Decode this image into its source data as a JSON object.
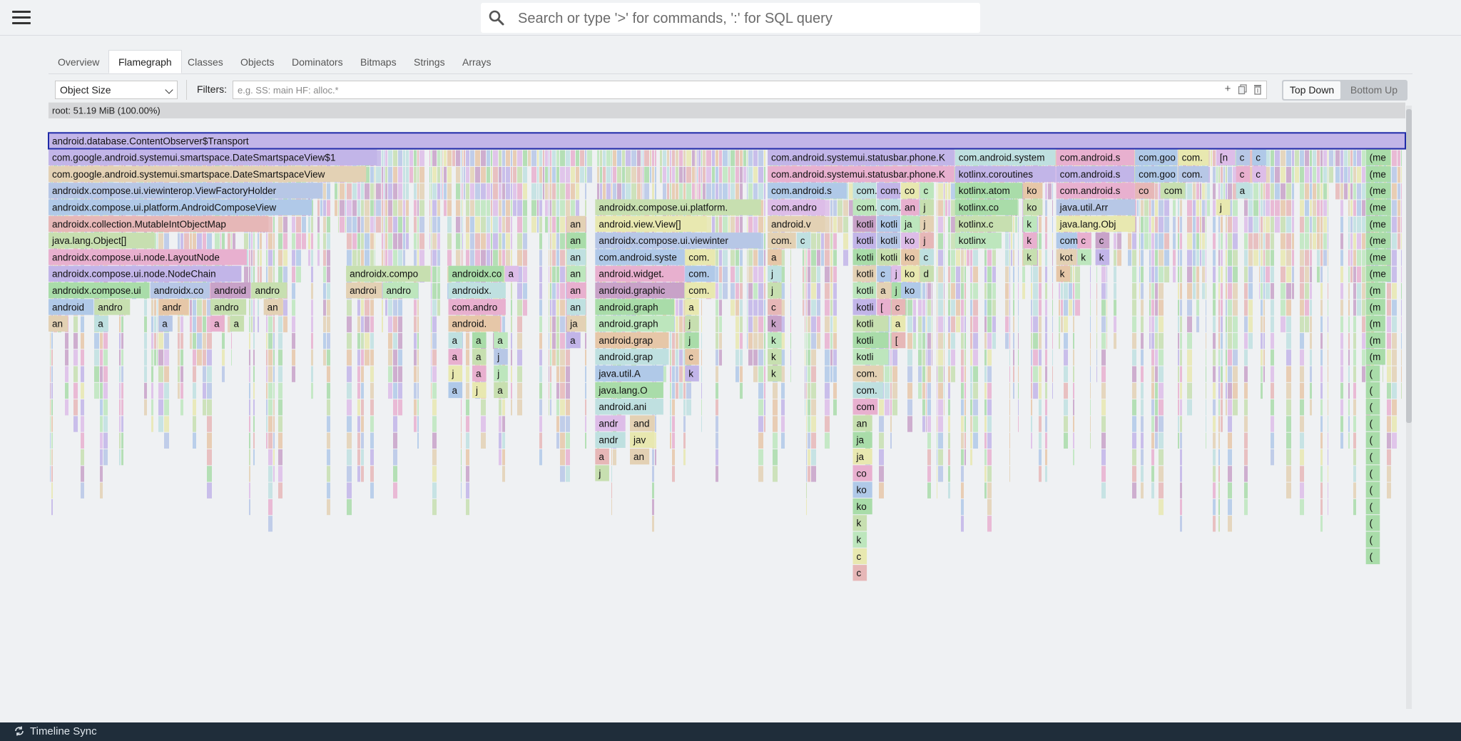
{
  "search": {
    "placeholder": "Search or type '>' for commands, ':' for SQL query"
  },
  "tabs": [
    {
      "label": "Overview",
      "active": false
    },
    {
      "label": "Flamegraph",
      "active": true
    },
    {
      "label": "Classes",
      "active": false
    },
    {
      "label": "Objects",
      "active": false
    },
    {
      "label": "Dominators",
      "active": false
    },
    {
      "label": "Bitmaps",
      "active": false
    },
    {
      "label": "Strings",
      "active": false
    },
    {
      "label": "Arrays",
      "active": false
    }
  ],
  "controls": {
    "metric": "Object Size",
    "filters_label": "Filters:",
    "filters_placeholder": "e.g. SS: main HF: alloc.*",
    "add_icon": "plus-icon",
    "copy_icon": "copy-icon",
    "delete_icon": "trash-icon",
    "top_down": "Top Down",
    "bottom_up": "Bottom Up"
  },
  "flame": {
    "colors": [
      "#c8a2c8",
      "#b7c7e6",
      "#bde6bd",
      "#e6c7a8",
      "#e6b7b7",
      "#bfe0e0",
      "#ddbde8",
      "#e8e8b0",
      "#a9dca9",
      "#c2b5e8",
      "#e8b0cf",
      "#c7dfb0",
      "#b0c9e8",
      "#e3d1b4"
    ],
    "root_label": "root: 51.19 MiB (100.00%)",
    "selected_label": "android.database.ContentObserver$Transport",
    "frames": [
      [
        3,
        0,
        "android.database.ContentObserver$Transport",
        9,
        1
      ],
      [
        4,
        0,
        "com.google.android.systemui.smartspace.DateSmartspaceView$1",
        9
      ],
      [
        4,
        0.53,
        "com.android.systemui.statusbar.phone.K",
        9
      ],
      [
        4,
        0.6681,
        "com.android.system",
        5
      ],
      [
        4,
        0.7427,
        "com.android.s",
        10
      ],
      [
        4,
        0.8008,
        "com.goo",
        12
      ],
      [
        4,
        0.8326,
        "com.",
        7
      ],
      [
        4,
        0.8606,
        "[n",
        6
      ],
      [
        4,
        0.8752,
        "c",
        1
      ],
      [
        4,
        0.8871,
        "c",
        12
      ],
      [
        4,
        0.9709,
        "(me",
        8
      ],
      [
        5,
        0,
        "com.google.android.systemui.smartspace.DateSmartspaceView",
        13
      ],
      [
        5,
        0.53,
        "com.android.systemui.statusbar.phone.K",
        10
      ],
      [
        5,
        0.6681,
        "kotlinx.coroutines",
        9
      ],
      [
        5,
        0.7427,
        "com.android.s",
        9
      ],
      [
        5,
        0.8008,
        "com.goo",
        12
      ],
      [
        5,
        0.8326,
        "com.",
        1
      ],
      [
        5,
        0.8752,
        "c",
        10
      ],
      [
        5,
        0.8871,
        "c",
        6
      ],
      [
        5,
        0.9709,
        "(me",
        8
      ],
      [
        6,
        0,
        "androidx.compose.ui.viewinterop.ViewFactoryHolder",
        1
      ],
      [
        6,
        0.53,
        "com.android.s",
        12
      ],
      [
        6,
        0.5928,
        "com.a",
        5
      ],
      [
        6,
        0.6105,
        "com.a",
        9
      ],
      [
        6,
        0.6283,
        "co",
        7
      ],
      [
        6,
        0.6422,
        "c",
        2
      ],
      [
        6,
        0.6681,
        "kotlinx.atom",
        8
      ],
      [
        6,
        0.7183,
        "ko",
        3
      ],
      [
        6,
        0.7427,
        "com.android.s",
        10
      ],
      [
        6,
        0.8008,
        "co",
        4
      ],
      [
        6,
        0.8195,
        "com",
        11
      ],
      [
        6,
        0.8752,
        "a",
        5
      ],
      [
        6,
        0.9709,
        "(me",
        8
      ],
      [
        7,
        0,
        "androidx.compose.ui.platform.AndroidComposeView",
        12
      ],
      [
        7,
        0.4029,
        "androidx.compose.ui.platform.",
        11
      ],
      [
        7,
        0.53,
        "com.andro",
        6
      ],
      [
        7,
        0.5928,
        "com.a",
        2
      ],
      [
        7,
        0.6105,
        "com.a",
        5
      ],
      [
        7,
        0.6283,
        "an",
        10
      ],
      [
        7,
        0.6422,
        "j",
        11
      ],
      [
        7,
        0.6681,
        "kotlinx.co",
        8
      ],
      [
        7,
        0.7183,
        "ko",
        11
      ],
      [
        7,
        0.7427,
        "java.util.Arr",
        1
      ],
      [
        7,
        0.8606,
        "j",
        7
      ],
      [
        7,
        0.9709,
        "(me",
        8
      ],
      [
        8,
        0,
        "androidx.collection.MutableIntObjectMap",
        4
      ],
      [
        8,
        0.3818,
        "an",
        13
      ],
      [
        8,
        0.4029,
        "android.view.View[]",
        7
      ],
      [
        8,
        0.53,
        "android.v",
        13
      ],
      [
        8,
        0.5928,
        "kotli",
        0
      ],
      [
        8,
        0.6105,
        "kotli",
        12
      ],
      [
        8,
        0.6283,
        "ja",
        2
      ],
      [
        8,
        0.6422,
        "j",
        13
      ],
      [
        8,
        0.6681,
        "kotlinx.c",
        11
      ],
      [
        8,
        0.7183,
        "k",
        2
      ],
      [
        8,
        0.7427,
        "java.lang.Obj",
        7
      ],
      [
        8,
        0.9709,
        "(me",
        8
      ],
      [
        9,
        0,
        "java.lang.Object[]",
        11
      ],
      [
        9,
        0.3818,
        "an",
        8
      ],
      [
        9,
        0.4029,
        "androidx.compose.ui.viewinter",
        1
      ],
      [
        9,
        0.53,
        "com.",
        13
      ],
      [
        9,
        0.5514,
        "c",
        5
      ],
      [
        9,
        0.5928,
        "kotli",
        9
      ],
      [
        9,
        0.6105,
        "kotli",
        1
      ],
      [
        9,
        0.6283,
        "ko",
        6
      ],
      [
        9,
        0.6422,
        "j",
        4
      ],
      [
        9,
        0.6681,
        "kotlinx",
        2
      ],
      [
        9,
        0.7183,
        "k",
        10
      ],
      [
        9,
        0.7427,
        "com",
        12
      ],
      [
        9,
        0.7583,
        "c",
        10
      ],
      [
        9,
        0.7716,
        "c",
        0
      ],
      [
        9,
        0.9709,
        "(me",
        8
      ],
      [
        10,
        0,
        "androidx.compose.ui.node.LayoutNode",
        10
      ],
      [
        10,
        0.3818,
        "an",
        5
      ],
      [
        10,
        0.4029,
        "com.android.syste",
        12
      ],
      [
        10,
        0.4691,
        "com.",
        7
      ],
      [
        10,
        0.53,
        "a",
        3
      ],
      [
        10,
        0.5928,
        "kotli",
        8
      ],
      [
        10,
        0.6105,
        "kotli",
        11
      ],
      [
        10,
        0.6283,
        "ko",
        3
      ],
      [
        10,
        0.6422,
        "c",
        5
      ],
      [
        10,
        0.7183,
        "k",
        11
      ],
      [
        10,
        0.7427,
        "kot",
        13
      ],
      [
        10,
        0.7583,
        "k",
        2
      ],
      [
        10,
        0.7716,
        "k",
        9
      ],
      [
        10,
        0.9709,
        "(me",
        8
      ],
      [
        11,
        0,
        "androidx.compose.ui.node.NodeChain",
        9
      ],
      [
        11,
        0.2193,
        "androidx.compo",
        11
      ],
      [
        11,
        0.2947,
        "androidx.co",
        8
      ],
      [
        11,
        0.3362,
        "a",
        6
      ],
      [
        11,
        0.3818,
        "an",
        2
      ],
      [
        11,
        0.4029,
        "android.widget.",
        10
      ],
      [
        11,
        0.4691,
        "com.",
        12
      ],
      [
        11,
        0.53,
        "j",
        5
      ],
      [
        11,
        0.5928,
        "kotli",
        13
      ],
      [
        11,
        0.6105,
        "c",
        12
      ],
      [
        11,
        0.6213,
        "j",
        6
      ],
      [
        11,
        0.6283,
        "ko",
        7
      ],
      [
        11,
        0.6422,
        "d",
        11
      ],
      [
        11,
        0.7427,
        "k",
        3
      ],
      [
        11,
        0.9709,
        "(me",
        8
      ],
      [
        12,
        0,
        "androidx.compose.ui",
        8
      ],
      [
        12,
        0.075,
        "androidx.co",
        1
      ],
      [
        12,
        0.1194,
        "android",
        0
      ],
      [
        12,
        0.1496,
        "andro",
        11
      ],
      [
        12,
        0.2193,
        "androi",
        13
      ],
      [
        12,
        0.2463,
        "andro",
        2
      ],
      [
        12,
        0.2947,
        "androidx.",
        5
      ],
      [
        12,
        0.3818,
        "an",
        10
      ],
      [
        12,
        0.4029,
        "android.graphic",
        0
      ],
      [
        12,
        0.4691,
        "com.",
        7
      ],
      [
        12,
        0.53,
        "j",
        11
      ],
      [
        12,
        0.5928,
        "kotli",
        2
      ],
      [
        12,
        0.6105,
        "a",
        13
      ],
      [
        12,
        0.6213,
        "j",
        8
      ],
      [
        12,
        0.6283,
        "ko",
        12
      ],
      [
        12,
        0.9709,
        "(m",
        8
      ],
      [
        13,
        0,
        "android",
        12
      ],
      [
        13,
        0.0338,
        "andro",
        11
      ],
      [
        13,
        0.0811,
        "andr",
        3
      ],
      [
        13,
        0.1194,
        "andro",
        11
      ],
      [
        13,
        0.1586,
        "an",
        13
      ],
      [
        13,
        0.2947,
        "com.andro",
        10
      ],
      [
        13,
        0.3818,
        "an",
        5
      ],
      [
        13,
        0.4029,
        "android.graph",
        8
      ],
      [
        13,
        0.4691,
        "a",
        7
      ],
      [
        13,
        0.53,
        "c",
        4
      ],
      [
        13,
        0.5928,
        "kotli",
        9
      ],
      [
        13,
        0.6105,
        "[",
        10
      ],
      [
        13,
        0.6213,
        "c",
        4
      ],
      [
        13,
        0.9709,
        "(m",
        8
      ],
      [
        14,
        0,
        "an",
        13
      ],
      [
        14,
        0.0338,
        "a",
        5
      ],
      [
        14,
        0.0811,
        "a",
        1
      ],
      [
        14,
        0.1194,
        "a",
        10
      ],
      [
        14,
        0.1338,
        "a",
        11
      ],
      [
        14,
        0.2947,
        "android.",
        3
      ],
      [
        14,
        0.3818,
        "ja",
        13
      ],
      [
        14,
        0.4029,
        "android.graph",
        2
      ],
      [
        14,
        0.4691,
        "j",
        11
      ],
      [
        14,
        0.53,
        "k",
        0
      ],
      [
        14,
        0.5928,
        "kotli",
        11
      ],
      [
        14,
        0.6213,
        "a",
        7
      ],
      [
        14,
        0.9709,
        "(m",
        8
      ],
      [
        15,
        0.2947,
        "a",
        5
      ],
      [
        15,
        0.3123,
        "a",
        8
      ],
      [
        15,
        0.3282,
        "a",
        2
      ],
      [
        15,
        0.3818,
        "a",
        9
      ],
      [
        15,
        0.4029,
        "android.grap",
        3
      ],
      [
        15,
        0.4691,
        "j",
        8
      ],
      [
        15,
        0.53,
        "k",
        2
      ],
      [
        15,
        0.5928,
        "kotli",
        8
      ],
      [
        15,
        0.6213,
        "[",
        4
      ],
      [
        15,
        0.9709,
        "(m",
        8
      ],
      [
        16,
        0.2947,
        "a",
        10
      ],
      [
        16,
        0.3123,
        "a",
        11
      ],
      [
        16,
        0.3282,
        "j",
        1
      ],
      [
        16,
        0.4029,
        "android.grap",
        5
      ],
      [
        16,
        0.4691,
        "c",
        3
      ],
      [
        16,
        0.53,
        "k",
        11
      ],
      [
        16,
        0.5928,
        "kotli",
        2
      ],
      [
        16,
        0.9709,
        "(m",
        8
      ],
      [
        17,
        0.2947,
        "j",
        7
      ],
      [
        17,
        0.3123,
        "a",
        10
      ],
      [
        17,
        0.3282,
        "j",
        2
      ],
      [
        17,
        0.4029,
        "java.util.A",
        12
      ],
      [
        17,
        0.4691,
        "k",
        9
      ],
      [
        17,
        0.53,
        "k",
        11
      ],
      [
        17,
        0.5928,
        "com.",
        13
      ],
      [
        17,
        0.9709,
        "(",
        8
      ],
      [
        18,
        0.2947,
        "a",
        12
      ],
      [
        18,
        0.3123,
        "j",
        7
      ],
      [
        18,
        0.3282,
        "a",
        11
      ],
      [
        18,
        0.4029,
        "java.lang.O",
        8
      ],
      [
        18,
        0.5928,
        "com.",
        5
      ],
      [
        18,
        0.9709,
        "(",
        8
      ],
      [
        19,
        0.4029,
        "android.ani",
        5
      ],
      [
        19,
        0.5928,
        "com",
        10
      ],
      [
        19,
        0.9709,
        "(",
        8
      ],
      [
        20,
        0.4029,
        "andr",
        6
      ],
      [
        20,
        0.4285,
        "and",
        13
      ],
      [
        20,
        0.5928,
        "an",
        11
      ],
      [
        20,
        0.9709,
        "(",
        8
      ],
      [
        21,
        0.4029,
        "andr",
        5
      ],
      [
        21,
        0.4285,
        "jav",
        7
      ],
      [
        21,
        0.5928,
        "ja",
        8
      ],
      [
        21,
        0.9709,
        "(",
        8
      ],
      [
        22,
        0.4029,
        "a",
        4
      ],
      [
        22,
        0.4285,
        "an",
        13
      ],
      [
        22,
        0.5928,
        "ja",
        7
      ],
      [
        22,
        0.9709,
        "(",
        8
      ],
      [
        23,
        0.4029,
        "j",
        11
      ],
      [
        23,
        0.5928,
        "co",
        10
      ],
      [
        23,
        0.9709,
        "(",
        8
      ],
      [
        24,
        0.5928,
        "ko",
        12
      ],
      [
        24,
        0.9709,
        "(",
        8
      ],
      [
        25,
        0.5928,
        "ko",
        8
      ],
      [
        25,
        0.9709,
        "(",
        8
      ],
      [
        26,
        0.5928,
        "k",
        11
      ],
      [
        26,
        0.9709,
        "(",
        8
      ],
      [
        27,
        0.5928,
        "k",
        2
      ],
      [
        27,
        0.9709,
        "(",
        8
      ],
      [
        28,
        0.5928,
        "c",
        7
      ],
      [
        28,
        0.9709,
        "(",
        8
      ],
      [
        29,
        0.5928,
        "c",
        4
      ]
    ]
  },
  "footer": {
    "label": "Timeline Sync",
    "icon": "sync-icon"
  }
}
